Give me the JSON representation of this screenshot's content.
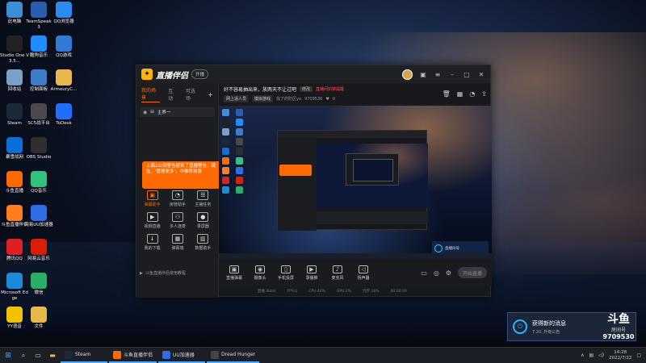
{
  "desktop": {
    "icons_col1": [
      {
        "label": "此电脑",
        "icon": "computer-icon",
        "color": "#3b8fd9"
      },
      {
        "label": "Studio One V3.5...",
        "icon": "studio-one-icon",
        "color": "#222222"
      },
      {
        "label": "回收站",
        "icon": "recycle-bin-icon",
        "color": "#7aa0c8"
      },
      {
        "label": "Steam",
        "icon": "steam-icon",
        "color": "#1b2838"
      },
      {
        "label": "暴雪战网",
        "icon": "battlenet-icon",
        "color": "#0a6fd8"
      },
      {
        "label": "斗鱼直播",
        "icon": "douyu-icon",
        "color": "#ff6a00"
      },
      {
        "label": "斗鱼直播伴侣",
        "icon": "douyu-companion-icon",
        "color": "#ff7d1a"
      },
      {
        "label": "腾讯QQ",
        "icon": "qq-icon",
        "color": "#e02020"
      },
      {
        "label": "Microsoft Edge",
        "icon": "edge-icon",
        "color": "#1a8bd8"
      },
      {
        "label": "YY语音",
        "icon": "yy-icon",
        "color": "#f2c200"
      }
    ],
    "icons_col2": [
      {
        "label": "TeamSpeak 3",
        "icon": "teamspeak-icon",
        "color": "#2a5db0"
      },
      {
        "label": "酷狗音乐",
        "icon": "kugou-icon",
        "color": "#1f8cff"
      },
      {
        "label": "控制面板",
        "icon": "control-panel-icon",
        "color": "#3c7cc8"
      },
      {
        "label": "SC5战平台",
        "icon": "sc5-icon",
        "color": "#4a4a4a"
      },
      {
        "label": "OBS Studio",
        "icon": "obs-icon",
        "color": "#302e31"
      },
      {
        "label": "QQ音乐",
        "icon": "qq-music-icon",
        "color": "#31c27c"
      },
      {
        "label": "网易UU加速器",
        "icon": "uu-icon",
        "color": "#2d6ee6"
      },
      {
        "label": "网易云音乐",
        "icon": "netease-music-icon",
        "color": "#d81e06"
      },
      {
        "label": "微信",
        "icon": "wechat-icon",
        "color": "#2aae67"
      },
      {
        "label": "文件",
        "icon": "folder-icon",
        "color": "#e8b84a"
      }
    ],
    "icons_col3": [
      {
        "label": "QQ浏览器",
        "icon": "qq-browser-icon",
        "color": "#2a8cf0"
      },
      {
        "label": "QQ游戏",
        "icon": "qq-game-icon",
        "color": "#2f7bd6"
      },
      {
        "label": "ArmouryC...",
        "icon": "folder-icon",
        "color": "#e8b84a"
      },
      {
        "label": "ToDesk",
        "icon": "todesk-icon",
        "color": "#1f6fff"
      }
    ]
  },
  "app": {
    "logo_text": "直播伴侣",
    "badge": "开播",
    "left_tabs": [
      "我的场景",
      "互动",
      "可选场"
    ],
    "scene_name": "主界一",
    "tooltip_text": "上面2公测警告提到了直播警告，现在，'管理更多'，中推荐场景",
    "tools": [
      {
        "label": "弹幕助手",
        "icon": "danmaku-icon",
        "active": true
      },
      {
        "label": "房管助手",
        "icon": "user-icon",
        "active": false
      },
      {
        "label": "主播任务",
        "icon": "task-icon",
        "active": false
      },
      {
        "label": "视频直播",
        "icon": "video-icon",
        "active": false
      },
      {
        "label": "多人连麦",
        "icon": "multi-user-icon",
        "active": false
      },
      {
        "label": "录屏器",
        "icon": "record-icon",
        "active": false
      },
      {
        "label": "我的下载",
        "icon": "download-icon",
        "active": false
      },
      {
        "label": "弹幕墙",
        "icon": "wall-icon",
        "active": false
      },
      {
        "label": "数据助手",
        "icon": "data-icon",
        "active": false
      }
    ],
    "left_footer": "斗鱼直播伴侣使用教程",
    "header": {
      "live_title": "好不容易抽出来，放两天不让过吧",
      "chip": "修改",
      "warn": "直播间封禁提醒",
      "category_chip": "网上适人员",
      "category2_chip": "模拟游戏",
      "room_info": "找了的防区yo",
      "room_id": "9709530",
      "fans": "0"
    },
    "controls": [
      {
        "label": "直播弹幕",
        "icon": "danmaku-icon"
      },
      {
        "label": "摄像头",
        "icon": "camera-icon"
      },
      {
        "label": "手机投屏",
        "icon": "phone-icon"
      },
      {
        "label": "录播推",
        "icon": "play-icon"
      },
      {
        "label": "麦克风",
        "icon": "mic-icon"
      },
      {
        "label": "扬声器",
        "icon": "speaker-icon"
      }
    ],
    "start_live": "开始直播",
    "status": [
      "直播 0kb/s",
      "FPS:0",
      "CPU:40%",
      "GPU:2%",
      "内存:16%",
      "00:00:00"
    ],
    "preview_watermark": "直播间号"
  },
  "toast": {
    "title": "获得新的消息",
    "subtitle": "7.20, 升级公告"
  },
  "douyu_watermark": {
    "logo": "斗鱼",
    "room_label": "房间号",
    "room_number": "9709530"
  },
  "taskbar": {
    "apps": [
      {
        "label": "Steam",
        "color": "#1b2838"
      },
      {
        "label": "斗鱼直播伴侣",
        "color": "#ff6a00"
      },
      {
        "label": "UU加速器",
        "color": "#2d6ee6"
      },
      {
        "label": "Dread Hunger",
        "color": "#444444"
      }
    ],
    "time": "14:28",
    "date": "2022/7/22"
  }
}
